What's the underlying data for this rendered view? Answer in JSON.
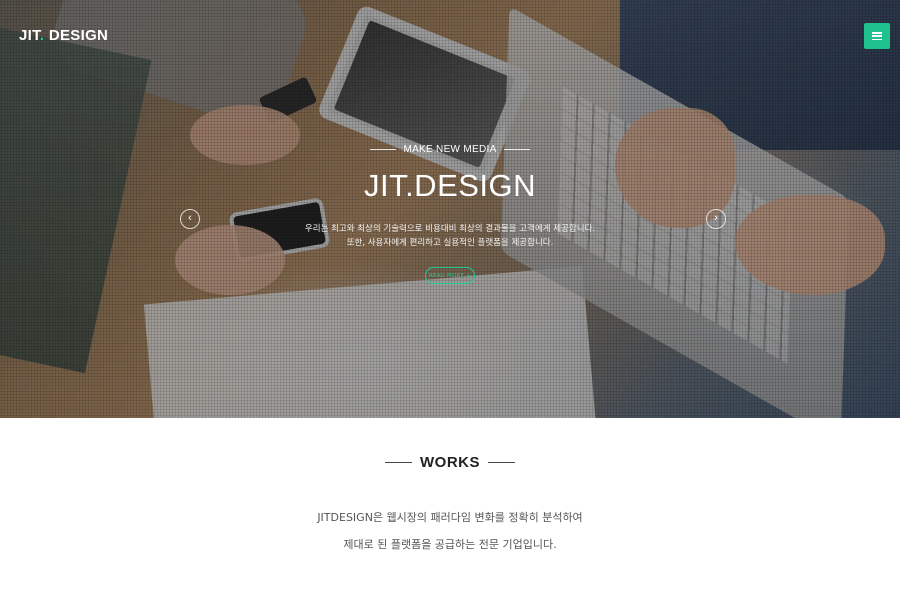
{
  "header": {
    "logo_text_1": "JIT",
    "logo_dot": ".",
    "logo_text_2": " DESIGN",
    "menu_icon": "hamburger-icon",
    "accent_color": "#1fc18f"
  },
  "hero": {
    "kicker": "MAKE NEW MEDIA",
    "title": "JIT.DESIGN",
    "desc_line_1": "우리는 최고와 최상의 기술력으로 비용대비 최상의 결과물을 고객에게 제공합니다.",
    "desc_line_2": "또한, 사용자에게 편리하고 실용적인 플랫폼을 제공합니다.",
    "read_more_label": "READ MORE +",
    "prev_arrow": "‹",
    "next_arrow": "›"
  },
  "works": {
    "heading": "WORKS",
    "line_1": "JITDESIGN은 웹시장의 패러다임 변화를 정확히 분석하여",
    "line_2": "제대로 된 플랫폼을 공급하는 전문 기업입니다."
  }
}
